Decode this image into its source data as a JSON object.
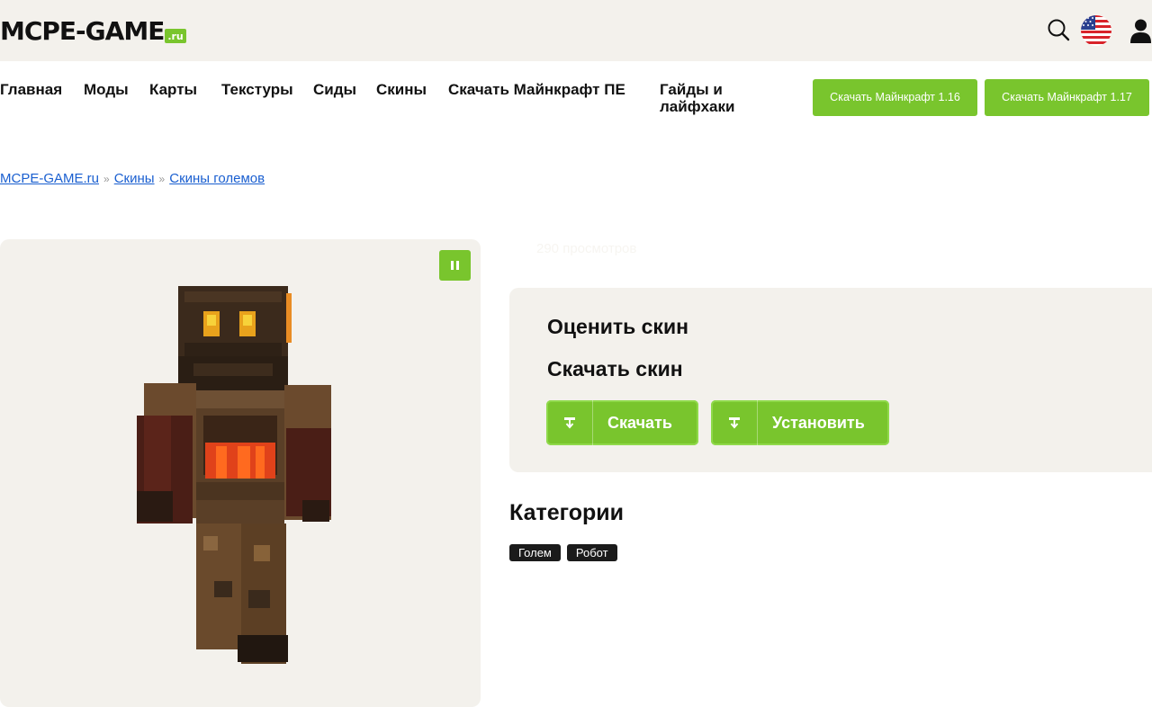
{
  "header": {
    "logo_main": "MCPE-GAME",
    "logo_suffix": ".ru",
    "icons": [
      "search-icon",
      "us-flag-icon",
      "user-icon"
    ]
  },
  "nav": {
    "items": [
      {
        "label": "Главная"
      },
      {
        "label": "Моды"
      },
      {
        "label": "Карты"
      },
      {
        "label": "Текстуры"
      },
      {
        "label": "Сиды"
      },
      {
        "label": "Скины"
      },
      {
        "label": "Скачать Майнкрафт ПЕ"
      },
      {
        "label": "Гайды и лайфхаки"
      }
    ],
    "download_buttons": [
      {
        "label": "Скачать Майнкрафт 1.16"
      },
      {
        "label": "Скачать Майнкрафт 1.17"
      }
    ]
  },
  "breadcrumb": {
    "items": [
      "MCPE-GAME.ru",
      "Скины",
      "Скины големов"
    ],
    "separator": "»"
  },
  "skin": {
    "views": "290 просмотров"
  },
  "actions": {
    "rate_title": "Оценить скин",
    "download_title": "Скачать скин",
    "download_label": "Скачать",
    "install_label": "Установить"
  },
  "categories": {
    "title": "Категории",
    "tags": [
      "Голем",
      "Робот"
    ]
  },
  "colors": {
    "accent": "#79c52d",
    "panel": "#f3f1ec",
    "link": "#1a5fd0",
    "tag_bg": "#1b1b1b"
  }
}
